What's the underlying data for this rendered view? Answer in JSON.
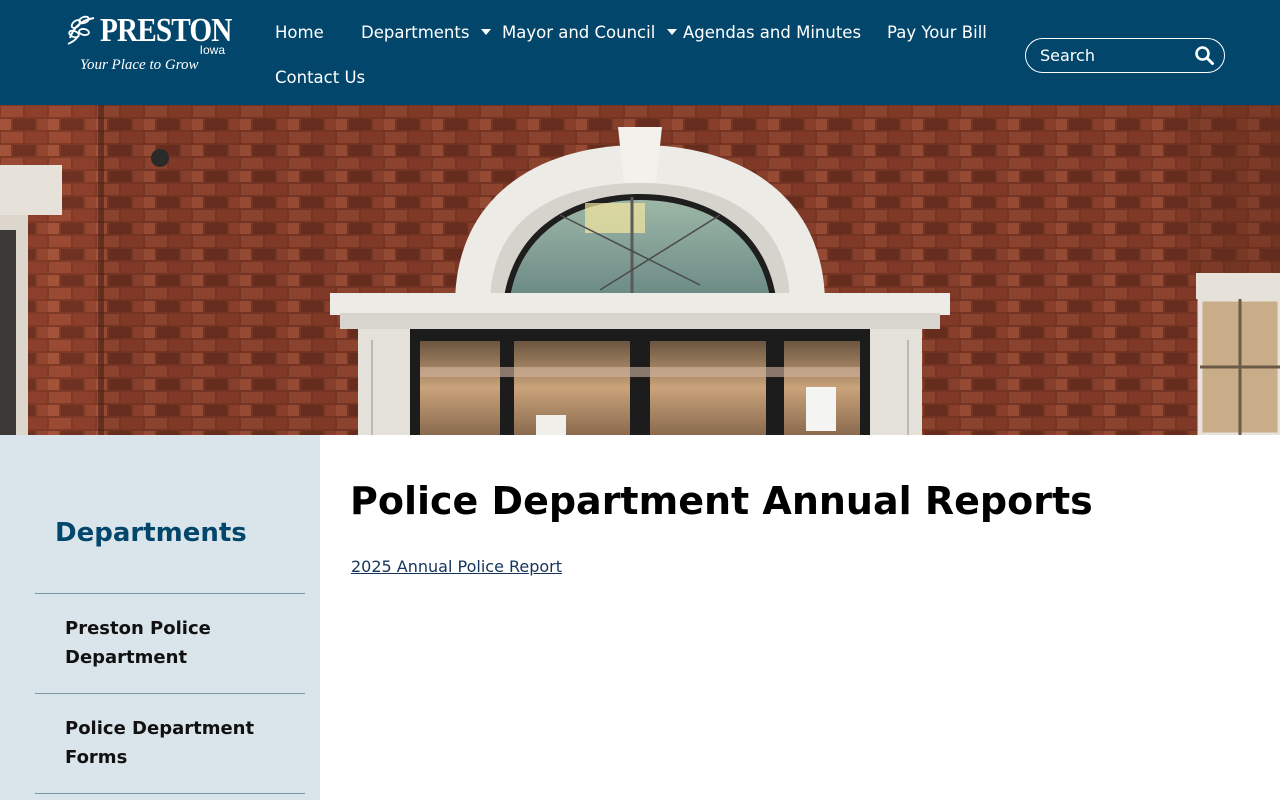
{
  "brand": {
    "name": "PRESTON",
    "state": "Iowa",
    "tagline": "Your Place to Grow",
    "header_color": "#03466b"
  },
  "nav": {
    "items": [
      {
        "label": "Home",
        "has_dropdown": false
      },
      {
        "label": "Departments",
        "has_dropdown": true
      },
      {
        "label": "Mayor and Council",
        "has_dropdown": true
      },
      {
        "label": "Agendas and Minutes",
        "has_dropdown": false
      },
      {
        "label": "Pay Your Bill",
        "has_dropdown": false
      },
      {
        "label": "Contact Us",
        "has_dropdown": false
      }
    ]
  },
  "search": {
    "placeholder": "Search",
    "value": "",
    "icon": "search-icon"
  },
  "hero": {
    "icon": "building-entrance-photo"
  },
  "sidebar": {
    "title": "Departments",
    "title_color": "#03466b",
    "items": [
      {
        "label": "Preston Police Department"
      },
      {
        "label": "Police Department Forms"
      }
    ]
  },
  "main": {
    "title": "Police Department Annual Reports",
    "links": [
      {
        "label": "2025 Annual Police Report"
      }
    ]
  }
}
